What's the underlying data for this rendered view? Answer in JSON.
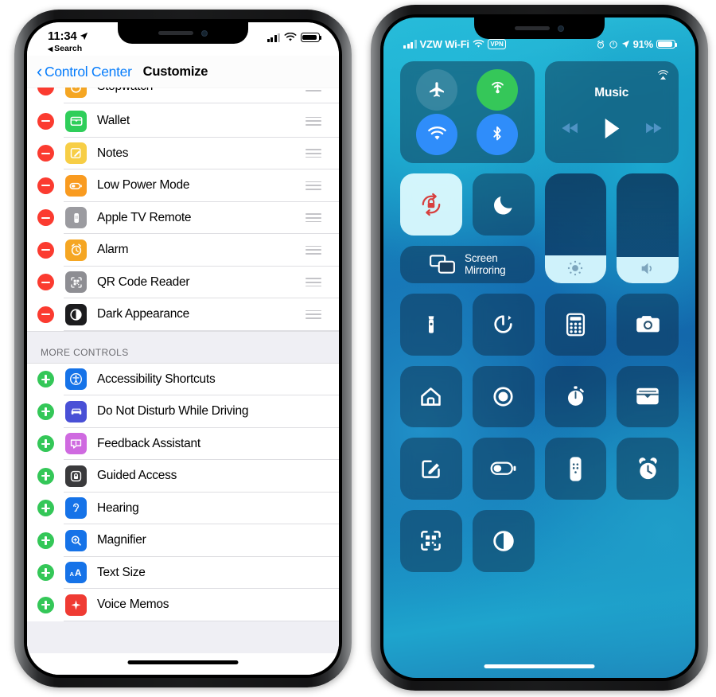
{
  "left_phone": {
    "status_bar": {
      "time": "11:34",
      "location_icon": "location-arrow-icon",
      "back_to_app": "Search",
      "signal_icon": "cellular-signal-icon",
      "wifi_icon": "wifi-icon",
      "battery_icon": "battery-icon"
    },
    "nav": {
      "back_label": "Control Center",
      "title": "Customize"
    },
    "included_controls": [
      {
        "label": "Stopwatch",
        "icon": "stopwatch-icon",
        "color": "#f5a623",
        "action": "remove",
        "clipped": true
      },
      {
        "label": "Wallet",
        "icon": "wallet-icon",
        "color": "#2fce5a",
        "action": "remove"
      },
      {
        "label": "Notes",
        "icon": "notes-icon",
        "color": "#f7ce46",
        "action": "remove"
      },
      {
        "label": "Low Power Mode",
        "icon": "low-power-mode-icon",
        "color": "#f99b20",
        "action": "remove"
      },
      {
        "label": "Apple TV Remote",
        "icon": "apple-tv-remote-icon",
        "color": "#9b9ba0",
        "action": "remove"
      },
      {
        "label": "Alarm",
        "icon": "alarm-icon",
        "color": "#f5a623",
        "action": "remove"
      },
      {
        "label": "QR Code Reader",
        "icon": "qr-code-reader-icon",
        "color": "#8e8e93",
        "action": "remove"
      },
      {
        "label": "Dark Appearance",
        "icon": "dark-appearance-icon",
        "color": "#1c1c1e",
        "action": "remove"
      }
    ],
    "more_controls_header": "MORE CONTROLS",
    "more_controls": [
      {
        "label": "Accessibility Shortcuts",
        "icon": "accessibility-icon",
        "color": "#1673e8",
        "action": "add"
      },
      {
        "label": "Do Not Disturb While Driving",
        "icon": "car-icon",
        "color": "#4950d6",
        "action": "add"
      },
      {
        "label": "Feedback Assistant",
        "icon": "feedback-assistant-icon",
        "color": "#cf6ae0",
        "action": "add"
      },
      {
        "label": "Guided Access",
        "icon": "guided-access-icon",
        "color": "#3a3a3c",
        "action": "add"
      },
      {
        "label": "Hearing",
        "icon": "hearing-icon",
        "color": "#1673e8",
        "action": "add"
      },
      {
        "label": "Magnifier",
        "icon": "magnifier-icon",
        "color": "#1673e8",
        "action": "add"
      },
      {
        "label": "Text Size",
        "icon": "text-size-icon",
        "color": "#1673e8",
        "action": "add"
      },
      {
        "label": "Voice Memos",
        "icon": "voice-memos-icon",
        "color": "#ef3b33",
        "action": "add"
      }
    ],
    "drag_handle_icon": "drag-handle-icon",
    "home_indicator": "home-indicator"
  },
  "right_phone": {
    "status_bar": {
      "signal_icon": "cellular-signal-icon",
      "carrier": "VZW Wi-Fi",
      "wifi_icon": "wifi-icon",
      "vpn_badge": "VPN",
      "alarm_icon": "alarm-clock-icon",
      "orientation_lock_icon": "orientation-lock-icon",
      "location_icon": "location-arrow-icon",
      "battery_percent": "91%",
      "battery_icon": "battery-icon"
    },
    "connectivity": {
      "airplane": {
        "icon": "airplane-mode-icon",
        "state": "off"
      },
      "cellular": {
        "icon": "cellular-data-icon",
        "state": "on"
      },
      "wifi": {
        "icon": "wifi-icon",
        "state": "on"
      },
      "bluetooth": {
        "icon": "bluetooth-icon",
        "state": "on"
      }
    },
    "media": {
      "title": "Music",
      "airplay_icon": "airplay-icon",
      "rewind_icon": "rewind-icon",
      "play_icon": "play-icon",
      "forward_icon": "fast-forward-icon"
    },
    "rotation_lock": {
      "icon": "rotation-lock-icon",
      "state": "on"
    },
    "do_not_disturb": {
      "icon": "moon-icon",
      "state": "off"
    },
    "screen_mirroring": {
      "icon": "screen-mirroring-icon",
      "label_line1": "Screen",
      "label_line2": "Mirroring"
    },
    "brightness": {
      "icon": "brightness-icon",
      "value": 25
    },
    "volume": {
      "icon": "volume-icon",
      "value": 24
    },
    "control_tiles": [
      {
        "icon": "flashlight-icon",
        "name": "flashlight"
      },
      {
        "icon": "timer-icon",
        "name": "timer"
      },
      {
        "icon": "calculator-icon",
        "name": "calculator"
      },
      {
        "icon": "camera-icon",
        "name": "camera"
      },
      {
        "icon": "home-icon",
        "name": "home"
      },
      {
        "icon": "screen-recording-icon",
        "name": "screen-recording"
      },
      {
        "icon": "stopwatch-icon",
        "name": "stopwatch"
      },
      {
        "icon": "wallet-icon",
        "name": "wallet"
      },
      {
        "icon": "notes-icon",
        "name": "notes"
      },
      {
        "icon": "low-power-mode-icon",
        "name": "low-power-mode"
      },
      {
        "icon": "apple-tv-remote-icon",
        "name": "apple-tv-remote"
      },
      {
        "icon": "alarm-icon",
        "name": "alarm"
      },
      {
        "icon": "qr-code-reader-icon",
        "name": "qr-code-reader"
      },
      {
        "icon": "dark-appearance-icon",
        "name": "dark-appearance"
      }
    ],
    "home_indicator": "home-indicator"
  }
}
